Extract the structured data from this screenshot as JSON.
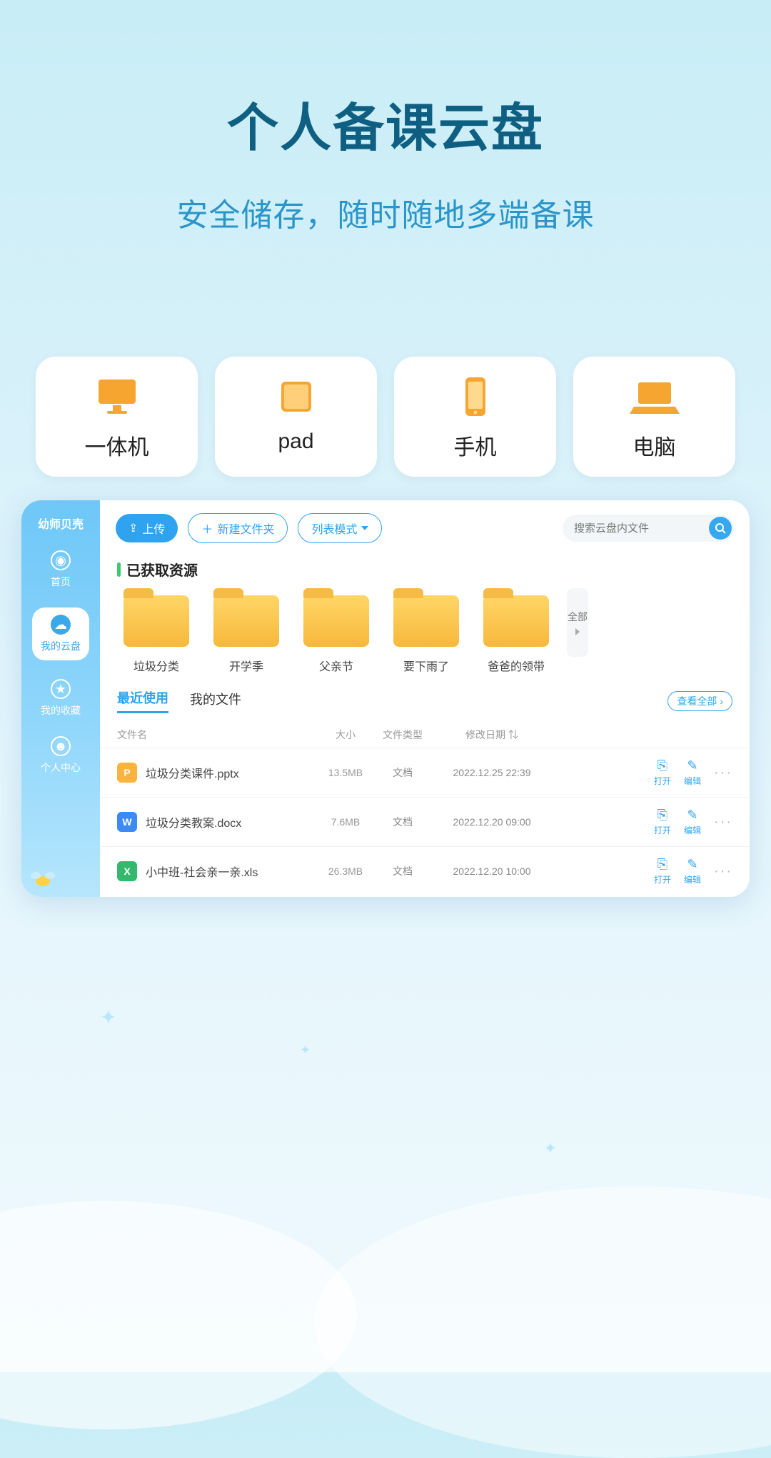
{
  "hero": {
    "title": "个人备课云盘",
    "subtitle": "安全储存，随时随地多端备课"
  },
  "devices": [
    {
      "label": "一体机",
      "icon": "monitor"
    },
    {
      "label": "pad",
      "icon": "tablet"
    },
    {
      "label": "手机",
      "icon": "phone"
    },
    {
      "label": "电脑",
      "icon": "laptop"
    }
  ],
  "sidebar": {
    "brand": "幼师贝壳",
    "items": [
      {
        "label": "首页",
        "icon": "home"
      },
      {
        "label": "我的云盘",
        "icon": "cloud",
        "active": true
      },
      {
        "label": "我的收藏",
        "icon": "star"
      },
      {
        "label": "个人中心",
        "icon": "user"
      }
    ]
  },
  "toolbar": {
    "upload": "上传",
    "newFolder": "新建文件夹",
    "viewMode": "列表模式",
    "searchPlaceholder": "搜索云盘内文件"
  },
  "resources": {
    "title": "已获取资源",
    "folders": [
      "垃圾分类",
      "开学季",
      "父亲节",
      "要下雨了",
      "爸爸的领带"
    ],
    "all": "全部"
  },
  "files": {
    "tabs": {
      "recent": "最近使用",
      "mine": "我的文件"
    },
    "viewAll": "查看全部",
    "cols": {
      "name": "文件名",
      "size": "大小",
      "type": "文件类型",
      "date": "修改日期"
    },
    "actions": {
      "open": "打开",
      "edit": "编辑"
    },
    "rows": [
      {
        "icon": "P",
        "iconClass": "fico-p",
        "name": "垃圾分类课件.pptx",
        "size": "13.5MB",
        "type": "文档",
        "date": "2022.12.25 22:39"
      },
      {
        "icon": "W",
        "iconClass": "fico-w",
        "name": "垃圾分类教案.docx",
        "size": "7.6MB",
        "type": "文档",
        "date": "2022.12.20 09:00"
      },
      {
        "icon": "X",
        "iconClass": "fico-x",
        "name": "小中班-社会亲一亲.xls",
        "size": "26.3MB",
        "type": "文档",
        "date": "2022.12.20 10:00"
      }
    ]
  }
}
